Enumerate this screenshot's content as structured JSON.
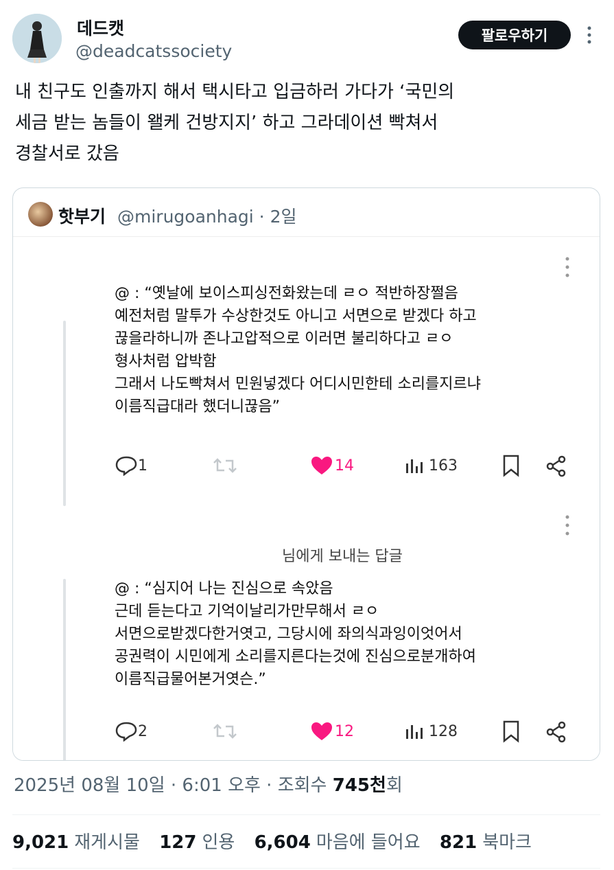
{
  "author": {
    "display_name": "데드캣",
    "handle": "@deadcatssociety",
    "follow_label": "팔로우하기"
  },
  "tweet": {
    "lines": [
      "내 친구도 인출까지 해서 택시타고 입금하러 가다가 ‘국민의",
      "세금 받는 놈들이 왤케 건방지지’ 하고 그라데이션 빡쳐서",
      "경찰서로 갔음"
    ]
  },
  "quote": {
    "display_name": "핫부기",
    "meta": "@mirugoanhagi · 2일",
    "replies": [
      {
        "lines": [
          "@ : “옛날에 보이스피싱전화왔는데 ㄹㅇ 적반하장쩔음",
          "예전처럼 말투가 수상한것도 아니고 서면으로 받겠다 하고",
          "끊을라하니까 존나고압적으로 이러면 불리하다고 ㄹㅇ",
          "형사처럼 압박함",
          "그래서 나도빡쳐서 민원넣겠다 어디시민한테 소리를지르냐",
          "이름직급대라 했더니끊음”"
        ],
        "replies_count": "1",
        "likes": "14",
        "views": "163"
      },
      {
        "label": "님에게 보내는 답글",
        "lines": [
          "@ : “심지어 나는 진심으로 속았음",
          "근데 듣는다고 기억이날리가만무해서 ㄹㅇ",
          "서면으로받겠다한거엿고, 그당시에 좌의식과잉이엇어서",
          "공권력이 시민에게 소리를지른다는것에 진심으로분개하여",
          "이름직급물어본거엿슨.”"
        ],
        "replies_count": "2",
        "likes": "12",
        "views": "128"
      }
    ]
  },
  "footer": {
    "date_prefix": "2025년 08월 10일 · 6:01 오후 · 조회수 ",
    "views_bold": "745천",
    "views_suffix": "회",
    "stats": [
      {
        "value": "9,021",
        "label": "재게시물"
      },
      {
        "value": "127",
        "label": "인용"
      },
      {
        "value": "6,604",
        "label": "마음에 들어요"
      },
      {
        "value": "821",
        "label": "북마크"
      }
    ]
  },
  "colors": {
    "like_pink": "#f91880",
    "muted": "#536471",
    "border": "#cfd9de"
  },
  "icons": [
    "more-icon",
    "reply-icon",
    "retweet-icon",
    "heart-icon",
    "views-icon",
    "bookmark-icon",
    "share-icon"
  ]
}
